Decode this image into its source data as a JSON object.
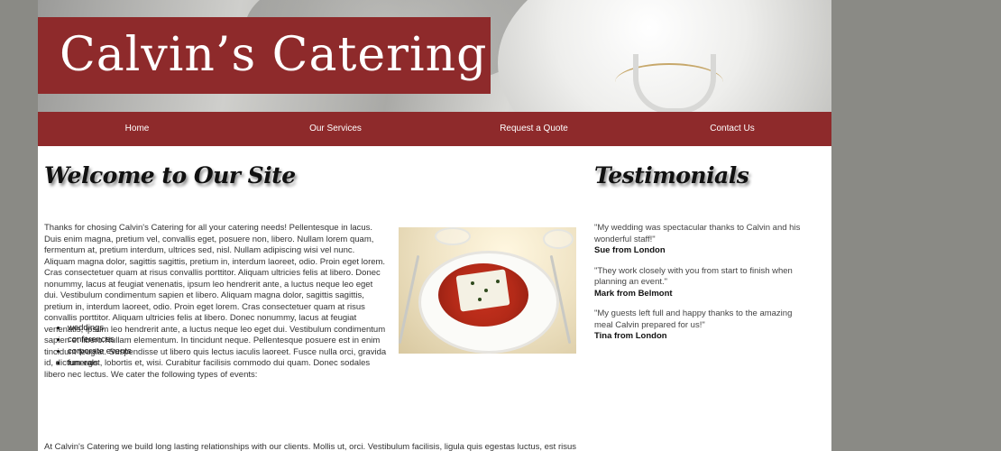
{
  "site": {
    "brand": "Calvin’s Catering"
  },
  "nav": {
    "items": [
      {
        "label": "Home"
      },
      {
        "label": "Our Services"
      },
      {
        "label": "Request a Quote"
      },
      {
        "label": "Contact Us"
      }
    ]
  },
  "main": {
    "heading": "Welcome to Our Site",
    "intro": "Thanks for chosing Calvin's Catering for all your catering needs! Pellentesque in lacus. Duis enim magna, pretium vel, convallis eget, posuere non, libero. Nullam lorem quam, fermentum at, pretium interdum, ultrices sed, nisl. Nullam adipiscing wisi vel nunc. Aliquam magna dolor, sagittis sagittis, pretium in, interdum laoreet, odio. Proin eget lorem. Cras consectetuer quam at risus convallis porttitor. Aliquam ultricies felis at libero. Donec nonummy, lacus at feugiat venenatis, ipsum leo hendrerit ante, a luctus neque leo eget dui. Vestibulum condimentum sapien et libero. Aliquam magna dolor, sagittis sagittis, pretium in, interdum laoreet, odio. Proin eget lorem. Cras consectetuer quam at risus convallis porttitor. Aliquam ultricies felis at libero. Donec nonummy, lacus at feugiat venenatis, ipsum leo hendrerit ante, a luctus neque leo eget dui. Vestibulum condimentum sapien et libero.Nullam elementum. In tincidunt neque. Pellentesque posuere est in enim tincidunt feugiat. Suspendisse ut libero quis lectus iaculis laoreet. Fusce nulla orci, gravida id, dictum eget, lobortis et, wisi. Curabitur facilisis commodo dui quam. Donec sodales libero nec lectus. We cater the following types of events:",
    "events": [
      "weddings",
      "conferences",
      "corporate events",
      "funerals"
    ],
    "outro": "At Calvin's Catering we build long lasting relationships with our clients. Mollis ut, orci. Vestibulum facilisis, ligula quis egestas luctus, est risus mollis nisl"
  },
  "sidebar": {
    "heading": "Testimonials",
    "testimonials": [
      {
        "quote": "\"My wedding was spectacular thanks to Calvin and his wonderful staff!\"",
        "author": "Sue from London"
      },
      {
        "quote": "\"They work closely with you from start to finish when planning an event.\"",
        "author": "Mark from Belmont"
      },
      {
        "quote": "\"My guests left full and happy thanks to the amazing meal Calvin prepared for us!\"",
        "author": "Tina from London"
      }
    ]
  },
  "colors": {
    "brand": "#8e2a2b",
    "background": "#8a8a85"
  }
}
